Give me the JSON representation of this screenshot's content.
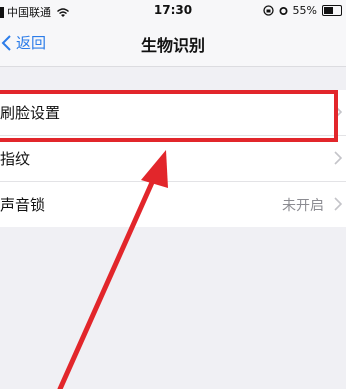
{
  "status_bar": {
    "carrier": "中国联通",
    "time": "17:30",
    "battery": "55%",
    "battery_level": 0.55
  },
  "nav": {
    "back_label": "返回",
    "title": "生物识别"
  },
  "settings": {
    "items": [
      {
        "label": "刷脸设置",
        "value": ""
      },
      {
        "label": "指纹",
        "value": ""
      },
      {
        "label": "声音锁",
        "value": "未开启"
      }
    ]
  },
  "annotation": {
    "color": "#e2262b",
    "highlighted_item": "刷脸设置"
  },
  "icons": [
    "wifi-icon",
    "lock-rotation-icon",
    "alarm-icon",
    "battery-icon",
    "back-chevron-icon",
    "chevron-right-icon"
  ]
}
